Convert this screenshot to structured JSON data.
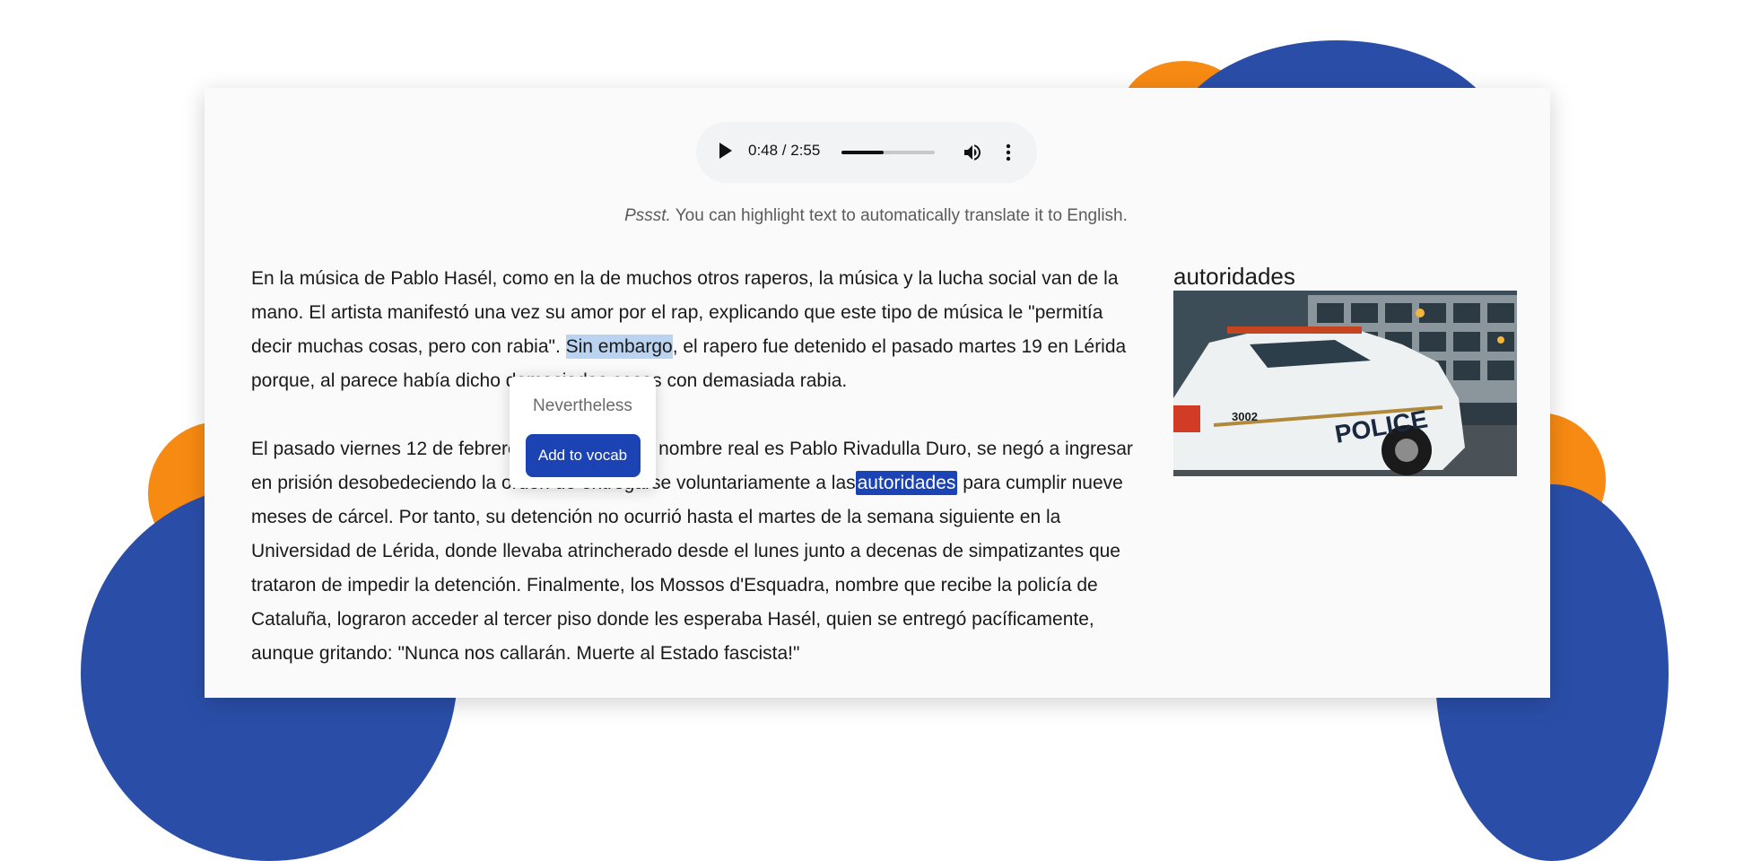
{
  "audio": {
    "time": "0:48 / 2:55",
    "progress_fraction": 0.45,
    "play_icon": "play-icon",
    "volume_icon": "volume-icon",
    "menu_icon": "more-vert-icon"
  },
  "hint": {
    "emphasis": "Pssst.",
    "text": " You can highlight text to automatically translate it to English."
  },
  "article": {
    "p1": {
      "before": "En la música de Pablo Hasél, como en la de muchos otros raperos, la música y la lucha social van de la mano. El artista manifestó una vez su amor por el rap, explicando que este tipo de música le \"permitía decir muchas cosas, pero con rabia\". ",
      "highlight": "Sin embargo",
      "after": ", el rapero fue detenido el pasado martes 19 en Lérida porque, al parece había dicho demasiadas cosas con demasiada rabia."
    },
    "p2": {
      "before": "El pasado viernes 12 de febrero, el rapero, cuyo nombre real es Pablo Rivadulla Duro, se negó a ingresar en prisión desobedeciendo la orden de entregarse voluntariamente a las",
      "selected": "autoridades",
      "after": " para cumplir nueve meses de cárcel. Por tanto, su detención no ocurrió hasta el martes de la semana siguiente en la Universidad de Lérida, donde llevaba atrincherado desde el lunes junto a decenas de simpatizantes que trataron de impedir la detención. Finalmente, los Mossos d'Esquadra, nombre que recibe la policía de Cataluña, lograron acceder al tercer piso donde les esperaba Hasél, quien se entregó pacíficamente, aunque gritando: \"Nunca nos callarán. Muerte al Estado fascista!\""
    }
  },
  "popup": {
    "translation": "Nevertheless",
    "button": "Add to vocab"
  },
  "sidebar": {
    "word": "autoridades",
    "image_label": "POLICE",
    "car_number": "3002"
  },
  "colors": {
    "brand_blue": "#1c43b4",
    "blob_blue": "#2a4ea8",
    "blob_orange": "#f78a12"
  }
}
